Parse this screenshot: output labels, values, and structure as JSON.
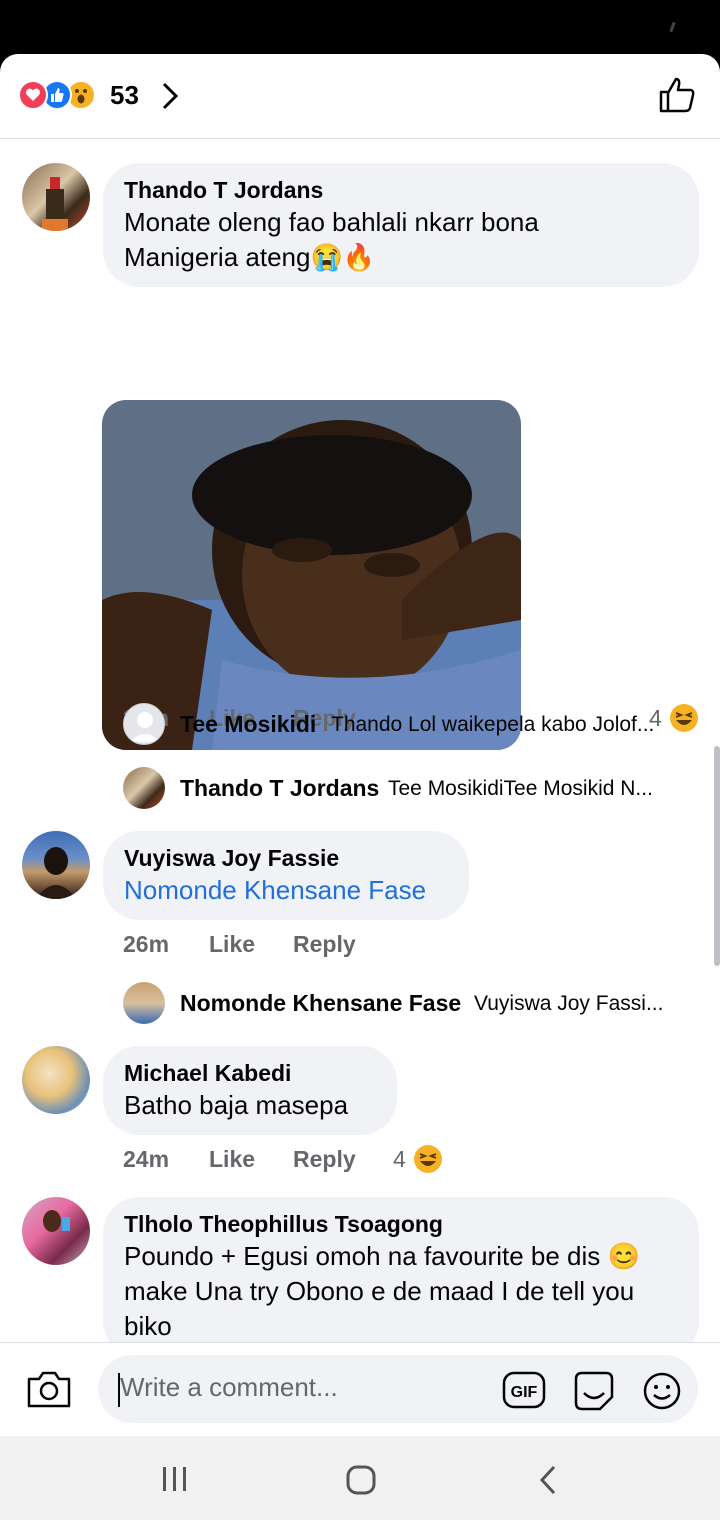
{
  "reactions": {
    "count": "53",
    "icons": [
      "love-icon",
      "like-icon",
      "wow-icon"
    ]
  },
  "comments": [
    {
      "author": "Thando T Jordans",
      "text_lines": [
        "Monate oleng fao bahlali nkarr bona",
        "Manigeria ateng😭🔥"
      ],
      "time": "31m",
      "like": "Like",
      "reply": "Reply",
      "reaction_count": "4"
    },
    {
      "author": "Vuyiswa Joy Fassie",
      "text_lines": [
        "Nomonde Khensane Fase"
      ],
      "time": "26m",
      "like": "Like",
      "reply": "Reply"
    },
    {
      "author": "Michael Kabedi",
      "text_lines": [
        "Batho baja masepa"
      ],
      "time": "24m",
      "like": "Like",
      "reply": "Reply",
      "reaction_count": "4"
    },
    {
      "author": "Tlholo Theophillus Tsoagong",
      "text_lines": [
        "Poundo + Egusi omoh na favourite be dis 😊",
        "make Una try Obono e de maad I de tell you",
        "biko"
      ]
    }
  ],
  "replies": [
    {
      "author": "Tee Mosikidi",
      "text": "Thando Lol waikepela kabo Jolof..."
    },
    {
      "author": "Thando T Jordans",
      "text": "Tee MosikidiTee Mosikid N..."
    },
    {
      "author": "Nomonde Khensane Fase",
      "text": "Vuyiswa Joy Fassi..."
    }
  ],
  "composer": {
    "placeholder": "Write a comment..."
  },
  "colors": {
    "link": "#216fdb",
    "bubble": "#f0f2f5",
    "meta": "#65676b",
    "love": "#f33e58",
    "like": "#1877f2"
  }
}
